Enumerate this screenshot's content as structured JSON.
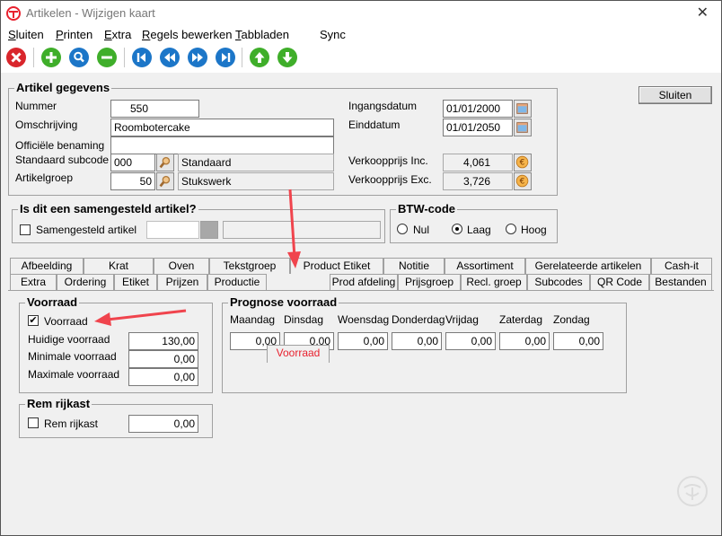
{
  "window": {
    "title": "Artikelen - Wijzigen kaart",
    "close_glyph": "✕"
  },
  "menu": [
    {
      "label": "Sluiten",
      "u": "S",
      "rest": "luiten"
    },
    {
      "label": "Printen",
      "u": "P",
      "rest": "rinten"
    },
    {
      "label": "Extra",
      "u": "E",
      "rest": "xtra"
    },
    {
      "label": "Regels bewerken",
      "u": "R",
      "rest": "egels bewerken"
    },
    {
      "label": "Tabbladen",
      "u": "T",
      "rest": "abbladen"
    },
    {
      "label": "Sync",
      "u": "",
      "rest": "Sync"
    }
  ],
  "sluiten_button": "Sluiten",
  "artikel": {
    "title": "Artikel gegevens",
    "nummer_label": "Nummer",
    "nummer": "550",
    "omschrijving_label": "Omschrijving",
    "omschrijving": "Roombotercake",
    "officiele_label": "Officiële benaming",
    "officiele": "",
    "subcode_label": "Standaard subcode",
    "subcode": "000",
    "subcode_desc": "Standaard",
    "groep_label": "Artikelgroep",
    "groep": "50",
    "groep_desc": "Stukswerk",
    "ingang_label": "Ingangsdatum",
    "ingang": "01/01/2000",
    "eind_label": "Einddatum",
    "eind": "01/01/2050",
    "vp_inc_label": "Verkoopprijs Inc.",
    "vp_inc": "4,061",
    "vp_exc_label": "Verkoopprijs Exc.",
    "vp_exc": "3,726"
  },
  "samengesteld": {
    "title": "Is dit een samengesteld artikel?",
    "check_label": "Samengesteld artikel"
  },
  "btw": {
    "title": "BTW-code",
    "options": [
      "Nul",
      "Laag",
      "Hoog"
    ],
    "selected": "Laag"
  },
  "tabs_row1": [
    "Afbeelding",
    "Krat",
    "Oven",
    "Tekstgroep",
    "Product Etiket",
    "Notitie",
    "Assortiment",
    "Gerelateerde artikelen",
    "Cash-it"
  ],
  "tabs_row2": [
    "Extra",
    "Ordering",
    "Etiket",
    "Prijzen",
    "Productie",
    "Voorraad",
    "Prod afdeling",
    "Prijsgroep",
    "Recl. groep",
    "Subcodes",
    "QR Code",
    "Bestanden"
  ],
  "active_tab": "Voorraad",
  "voorraad": {
    "title": "Voorraad",
    "check_label": "Voorraad",
    "checked": true,
    "huidig_label": "Huidige voorraad",
    "huidig": "130,00",
    "min_label": "Minimale voorraad",
    "min": "0,00",
    "max_label": "Maximale voorraad",
    "max": "0,00"
  },
  "prognose": {
    "title": "Prognose voorraad",
    "days": [
      "Maandag",
      "Dinsdag",
      "Woensdag",
      "Donderdag",
      "Vrijdag",
      "Zaterdag",
      "Zondag"
    ],
    "values": [
      "0,00",
      "0,00",
      "0,00",
      "0,00",
      "0,00",
      "0,00",
      "0,00"
    ]
  },
  "rem": {
    "title": "Rem rijkast",
    "check_label": "Rem rijkast",
    "value": "0,00"
  },
  "colors": {
    "active_tab": "#e8212e",
    "arrow": "#f0444d",
    "brand": "#e8212e"
  },
  "icons": {
    "toolbar": [
      "delete-icon",
      "add-icon",
      "search-icon",
      "remove-icon",
      "first-icon",
      "previous-icon",
      "next-icon",
      "last-icon",
      "up-icon",
      "down-icon"
    ],
    "lookup": "magnifier-icon",
    "calendar": "calendar-icon",
    "euro": "euro-icon",
    "check": "✔"
  }
}
